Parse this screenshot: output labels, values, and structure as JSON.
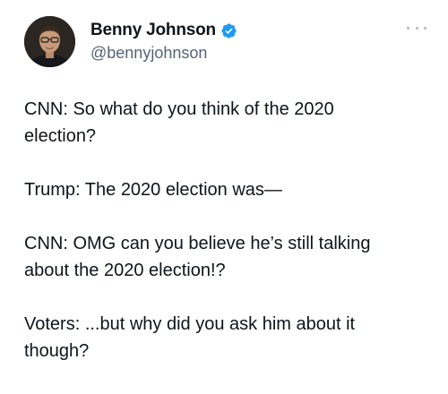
{
  "tweet": {
    "author": {
      "display_name": "Benny Johnson",
      "handle": "@bennyjohnson",
      "verified": true,
      "verified_icon": "verified-badge-icon",
      "verified_color": "#1d9bf0"
    },
    "more_icon": "more-options-icon",
    "paragraphs": [
      "CNN: So what do you think of the 2020\nelection?",
      "Trump: The 2020 election was—",
      "CNN: OMG can you believe he’s still talking\nabout the 2020 election!?",
      "Voters: ...but why did you ask him about it\nthough?"
    ]
  }
}
